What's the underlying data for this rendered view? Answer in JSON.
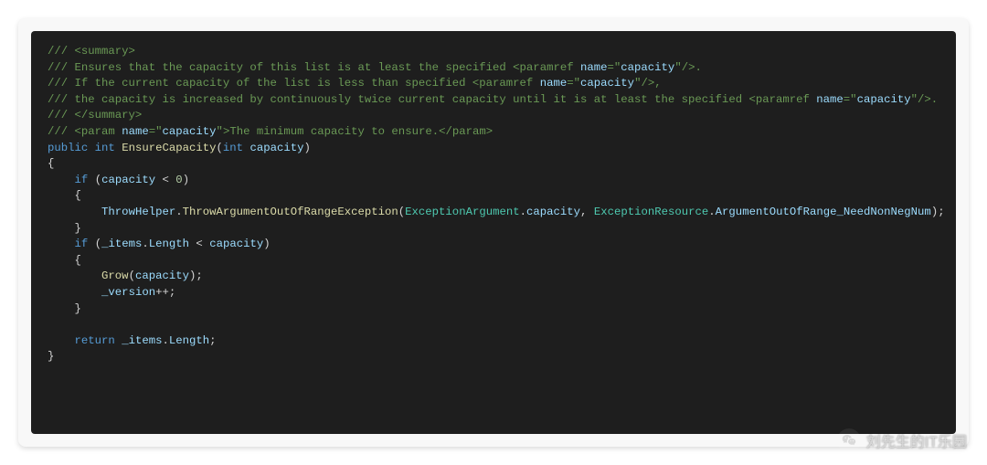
{
  "code": {
    "comment_lines": [
      "/// <summary>",
      "/// Ensures that the capacity of this list is at least the specified <paramref name=\"capacity\"/>.",
      "/// If the current capacity of the list is less than specified <paramref name=\"capacity\"/>,",
      "/// the capacity is increased by continuously twice current capacity until it is at least the specified <paramref name=\"capacity\"/>.",
      "/// </summary>",
      "/// <param name=\"capacity\">The minimum capacity to ensure.</param>"
    ],
    "paramref_name": "capacity",
    "param_desc": "The minimum capacity to ensure.",
    "access_modifier": "public",
    "return_type": "int",
    "method_name": "EnsureCapacity",
    "param_type": "int",
    "param_name": "capacity",
    "zero_literal": "0",
    "throw_helper": "ThrowHelper",
    "throw_method": "ThrowArgumentOutOfRangeException",
    "exception_argument_type": "ExceptionArgument",
    "exception_argument_member": "capacity",
    "exception_resource_type": "ExceptionResource",
    "exception_resource_member": "ArgumentOutOfRange_NeedNonNegNum",
    "items_field": "_items",
    "length_prop": "Length",
    "grow_method": "Grow",
    "version_field": "_version",
    "return_keyword": "return",
    "if_keyword": "if"
  },
  "watermark": {
    "text": "刘先生的IT乐园",
    "icon": "wechat-icon"
  }
}
